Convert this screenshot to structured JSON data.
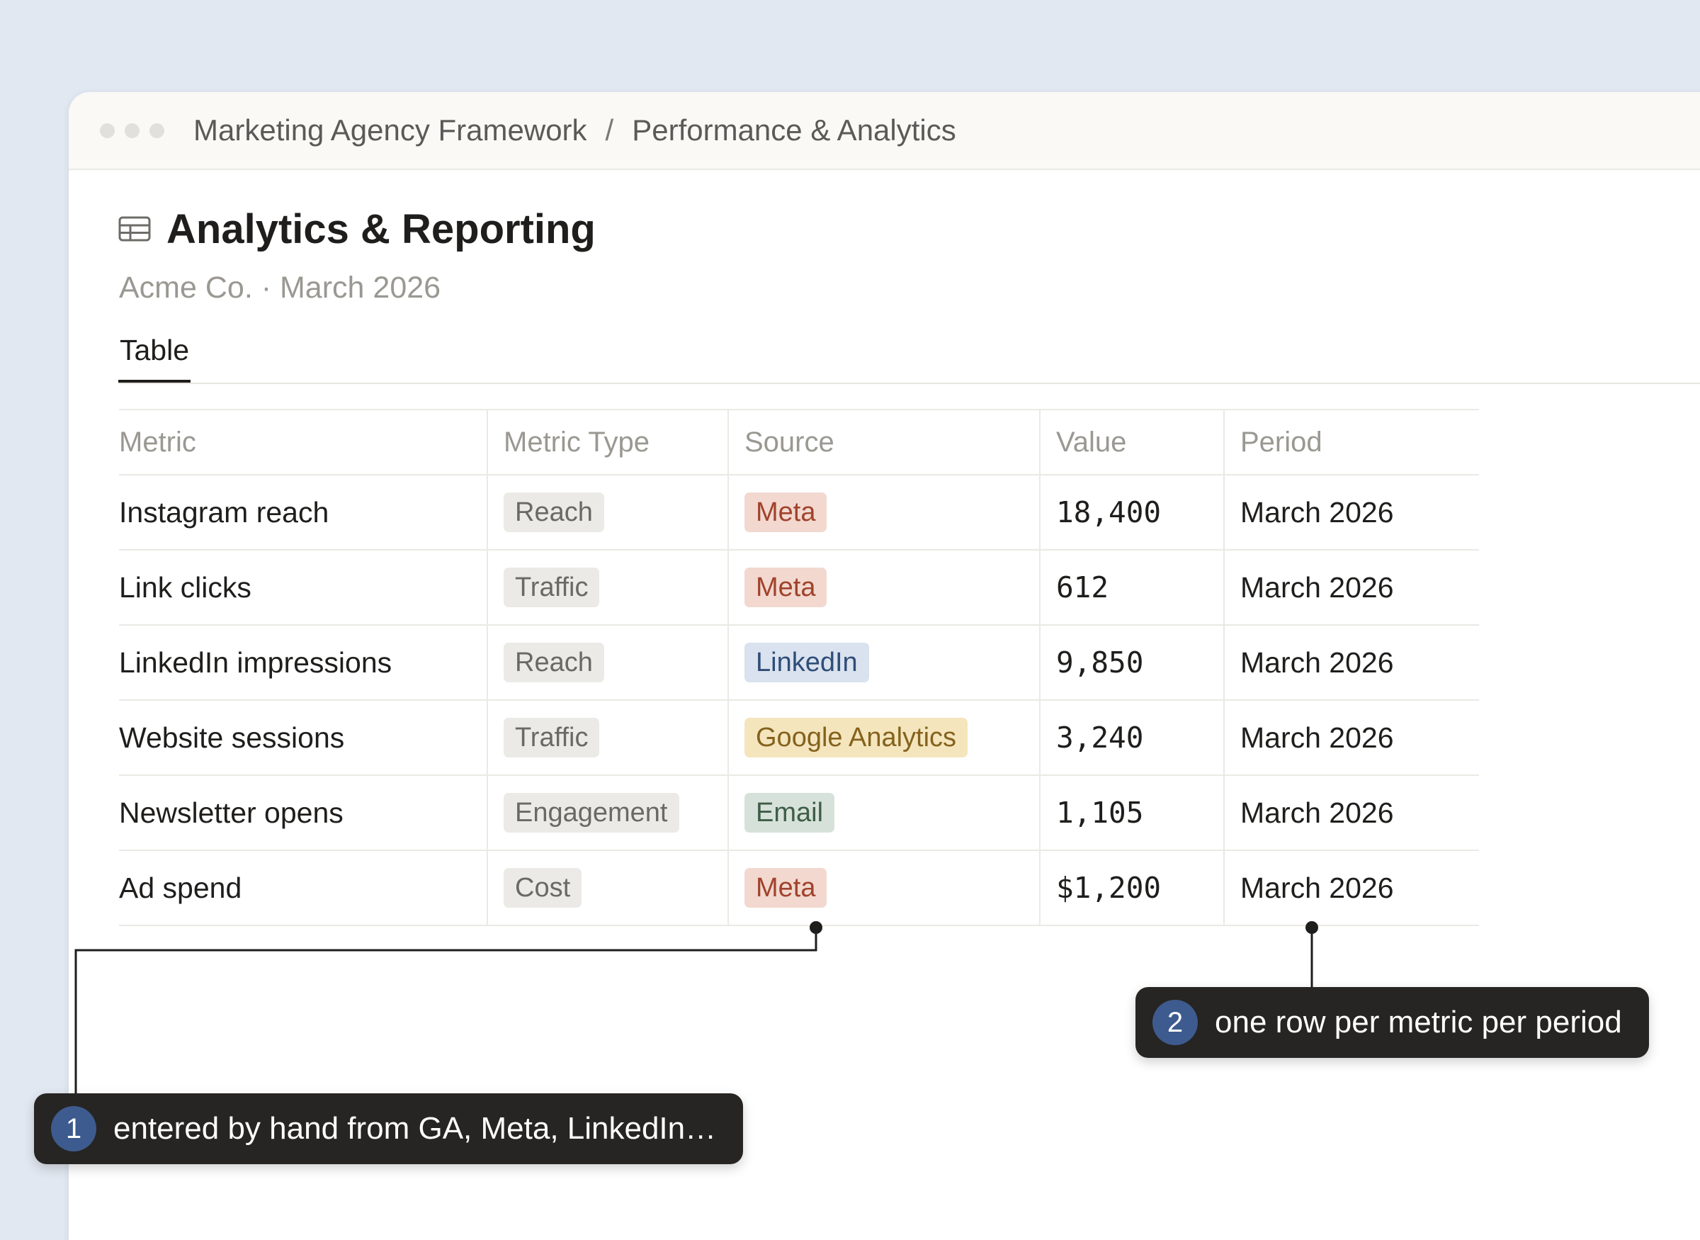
{
  "window": {
    "breadcrumb": [
      "Marketing Agency Framework",
      "Performance & Analytics"
    ],
    "breadcrumb_separator": "/"
  },
  "page": {
    "title": "Analytics & Reporting",
    "title_icon": "table-icon",
    "subtitle": "Acme Co. · March 2026",
    "tabs": [
      {
        "label": "Table",
        "active": true
      }
    ]
  },
  "table": {
    "columns": [
      "Metric",
      "Metric Type",
      "Source",
      "Value",
      "Period"
    ],
    "rows": [
      {
        "metric": "Instagram reach",
        "type": "Reach",
        "source": "Meta",
        "value": "18,400",
        "period": "March 2026"
      },
      {
        "metric": "Link clicks",
        "type": "Traffic",
        "source": "Meta",
        "value": "612",
        "period": "March 2026"
      },
      {
        "metric": "LinkedIn impressions",
        "type": "Reach",
        "source": "LinkedIn",
        "value": "9,850",
        "period": "March 2026"
      },
      {
        "metric": "Website sessions",
        "type": "Traffic",
        "source": "Google Analytics",
        "value": "3,240",
        "period": "March 2026"
      },
      {
        "metric": "Newsletter opens",
        "type": "Engagement",
        "source": "Email",
        "value": "1,105",
        "period": "March 2026"
      },
      {
        "metric": "Ad spend",
        "type": "Cost",
        "source": "Meta",
        "value": "$1,200",
        "period": "March 2026"
      }
    ]
  },
  "tag_colors": {
    "type": {
      "bg": "#eceae6",
      "fg": "#6b6964"
    },
    "Meta": {
      "bg": "#f2d8cf",
      "fg": "#a0432c"
    },
    "LinkedIn": {
      "bg": "#d9e2ee",
      "fg": "#2f4d78"
    },
    "Google Analytics": {
      "bg": "#f4e5bd",
      "fg": "#84621d"
    },
    "Email": {
      "bg": "#d6e2d9",
      "fg": "#3e5d47"
    }
  },
  "callouts": [
    {
      "number": "1",
      "text": "entered by hand from GA, Meta, LinkedIn…"
    },
    {
      "number": "2",
      "text": "one row per metric per period"
    }
  ],
  "colors": {
    "background": "#e2e8f1",
    "callout_bg": "#262523",
    "callout_badge": "#3e5b8f"
  }
}
